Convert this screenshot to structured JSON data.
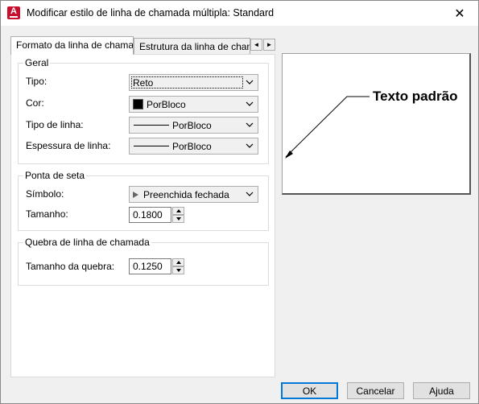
{
  "window": {
    "title": "Modificar estilo de linha de chamada múltipla: Standard",
    "close_glyph": "✕"
  },
  "tabs": [
    {
      "label": "Formato da linha de chamada",
      "active": true
    },
    {
      "label": "Estrutura da linha de chamada",
      "active": false
    }
  ],
  "tab_scroll": {
    "left": "◄",
    "right": "►"
  },
  "general": {
    "title": "Geral",
    "tipo_label": "Tipo:",
    "tipo_value": "Reto",
    "cor_label": "Cor:",
    "cor_value": "PorBloco",
    "tipo_linha_label": "Tipo de linha:",
    "tipo_linha_value": "PorBloco",
    "espessura_label": "Espessura de linha:",
    "espessura_value": "PorBloco"
  },
  "arrowhead": {
    "title": "Ponta de seta",
    "simbolo_label": "Símbolo:",
    "simbolo_value": "Preenchida fechada",
    "tamanho_label": "Tamanho:",
    "tamanho_value": "0.1800"
  },
  "landing_break": {
    "title": "Quebra de linha de chamada",
    "tamanho_label": "Tamanho da quebra:",
    "tamanho_value": "0.1250"
  },
  "preview": {
    "text": "Texto padrão"
  },
  "buttons": {
    "ok": "OK",
    "cancel": "Cancelar",
    "help": "Ajuda"
  }
}
